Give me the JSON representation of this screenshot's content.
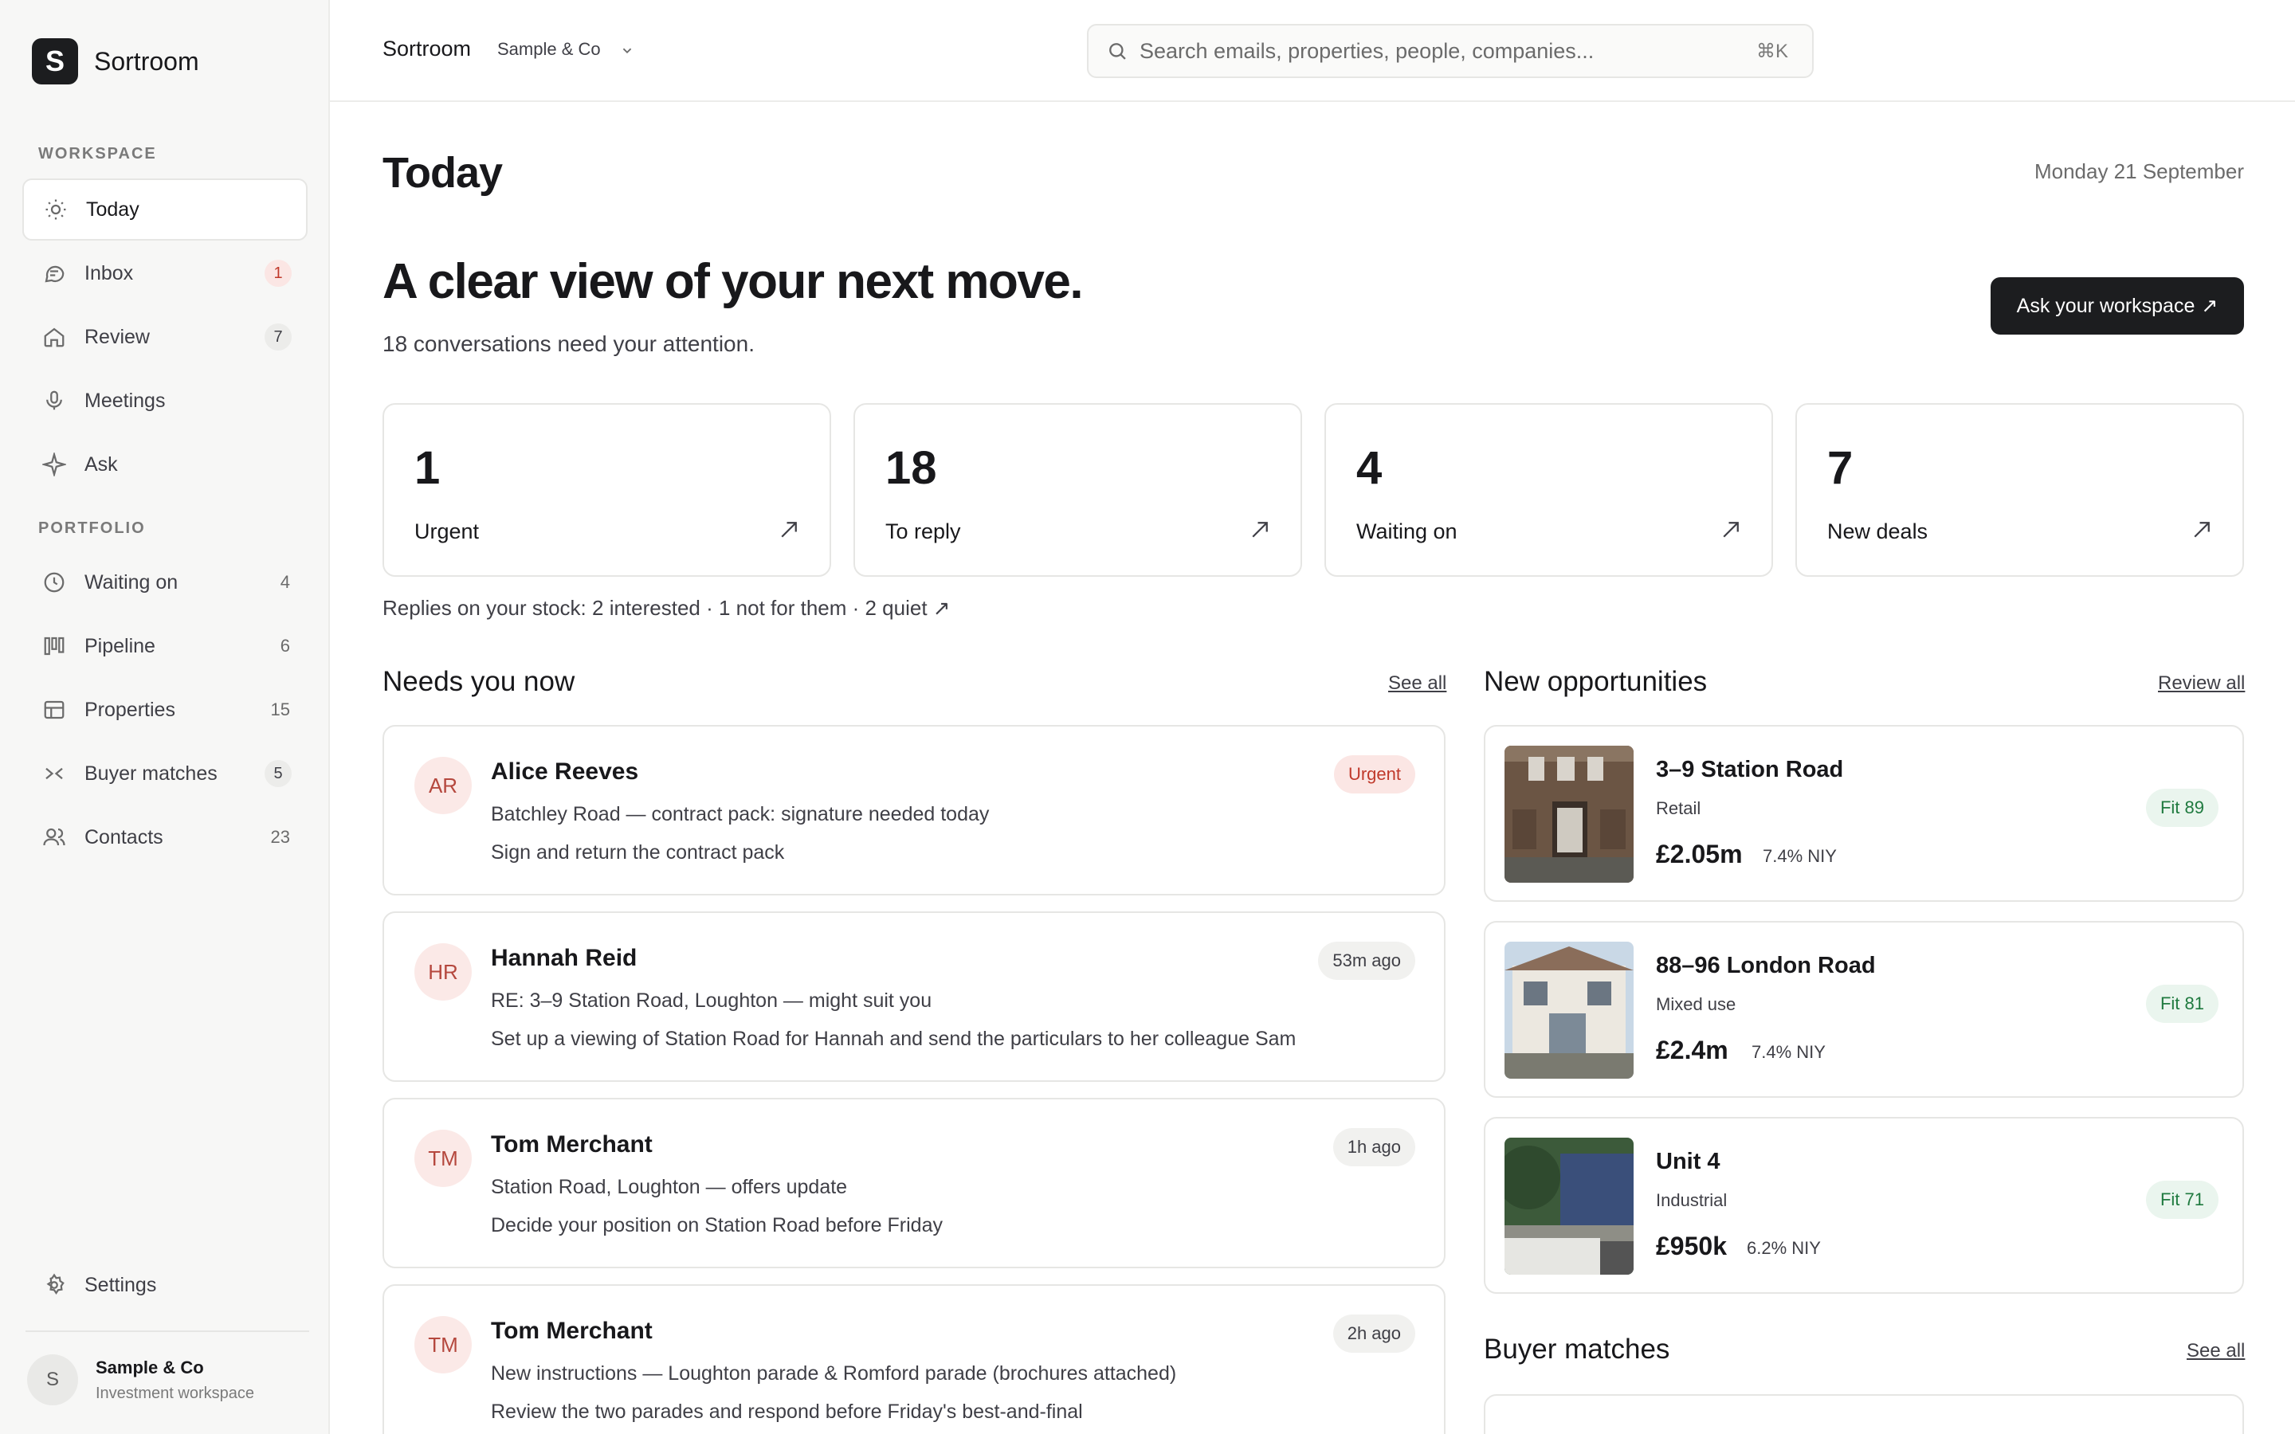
{
  "app": {
    "name": "Sortroom",
    "logo_letter": "S"
  },
  "sidebar": {
    "workspace_label": "WORKSPACE",
    "portfolio_label": "PORTFOLIO",
    "workspace_items": [
      {
        "label": "Today",
        "icon": "sun-icon",
        "active": true
      },
      {
        "label": "Inbox",
        "icon": "chat-icon",
        "badge": "1",
        "badge_color": "#c0392b"
      },
      {
        "label": "Review",
        "icon": "home-icon",
        "badge": "7"
      },
      {
        "label": "Meetings",
        "icon": "microphone-icon"
      },
      {
        "label": "Ask",
        "icon": "sparkle-icon"
      }
    ],
    "portfolio_items": [
      {
        "label": "Waiting on",
        "icon": "clock-icon",
        "count": "4"
      },
      {
        "label": "Pipeline",
        "icon": "kanban-icon",
        "count": "6"
      },
      {
        "label": "Properties",
        "icon": "table-icon",
        "count": "15"
      },
      {
        "label": "Buyer matches",
        "icon": "match-icon",
        "badge": "5"
      },
      {
        "label": "Contacts",
        "icon": "users-icon",
        "count": "23"
      }
    ],
    "settings_label": "Settings",
    "account": {
      "initial": "S",
      "name": "Sample & Co",
      "subtitle": "Investment workspace"
    }
  },
  "topbar": {
    "app_name": "Sortroom",
    "org_name": "Sample & Co",
    "search_placeholder": "Search emails, properties, people, companies...",
    "search_shortcut": "⌘K"
  },
  "main": {
    "title": "Today",
    "date": "Monday 21 September",
    "hero_title": "A clear view of your next move.",
    "hero_subtitle": "18 conversations need your attention.",
    "ask_button": "Ask your workspace",
    "ask_arrow": "↗",
    "stats": [
      {
        "value": "1",
        "label": "Urgent"
      },
      {
        "value": "18",
        "label": "To reply"
      },
      {
        "value": "4",
        "label": "Waiting on"
      },
      {
        "value": "7",
        "label": "New deals"
      }
    ],
    "replies_summary": "Replies on your stock: 2 interested · 1 not for them · 2 quiet ↗",
    "needs": {
      "title": "Needs you now",
      "link": "See all",
      "items": [
        {
          "initials": "AR",
          "name": "Alice Reeves",
          "subject": "Batchley Road — contract pack: signature needed today",
          "action": "Sign and return the contract pack",
          "tag": "Urgent",
          "tag_kind": "urgent"
        },
        {
          "initials": "HR",
          "name": "Hannah Reid",
          "subject": "RE: 3–9 Station Road, Loughton — might suit you",
          "action": "Set up a viewing of Station Road for Hannah and send the particulars to her colleague Sam",
          "tag": "53m ago",
          "tag_kind": "time"
        },
        {
          "initials": "TM",
          "name": "Tom Merchant",
          "subject": "Station Road, Loughton — offers update",
          "action": "Decide your position on Station Road before Friday",
          "tag": "1h ago",
          "tag_kind": "time"
        },
        {
          "initials": "TM",
          "name": "Tom Merchant",
          "subject": "New instructions — Loughton parade & Romford parade (brochures attached)",
          "action": "Review the two parades and respond before Friday's best-and-final",
          "tag": "2h ago",
          "tag_kind": "time"
        }
      ]
    },
    "opportunities": {
      "title": "New opportunities",
      "link": "Review all",
      "items": [
        {
          "name": "3–9 Station Road",
          "type": "Retail",
          "price": "£2.05m",
          "yield": "7.4% NIY",
          "fit": "Fit 89"
        },
        {
          "name": "88–96 London Road",
          "type": "Mixed use",
          "price": "£2.4m",
          "yield": "7.4% NIY",
          "fit": "Fit 81"
        },
        {
          "name": "Unit 4",
          "type": "Industrial",
          "price": "£950k",
          "yield": "6.2% NIY",
          "fit": "Fit 71"
        }
      ]
    },
    "buyer_matches": {
      "title": "Buyer matches",
      "link": "See all"
    }
  }
}
